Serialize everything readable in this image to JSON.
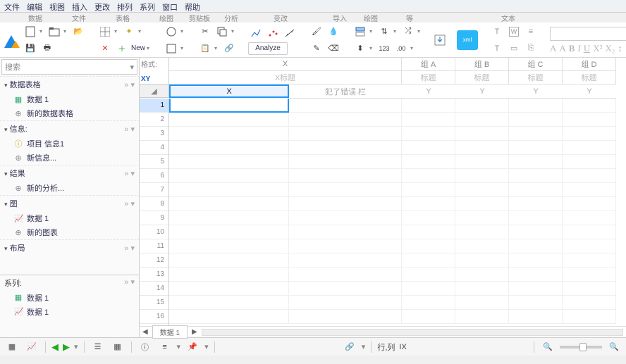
{
  "menu": [
    "文件",
    "编辑",
    "视图",
    "插入",
    "更改",
    "排列",
    "系列",
    "窗口",
    "帮助"
  ],
  "groups": [
    "数据",
    "文件",
    "表格",
    "绘图",
    "剪贴板",
    "分析",
    "变改",
    "导入",
    "绘图",
    "等",
    "文本"
  ],
  "toolbar": {
    "new_label": "New",
    "analyze_label": "Analyze"
  },
  "search": {
    "placeholder": "搜索"
  },
  "sidebar": {
    "sections": [
      {
        "title": "数据表格",
        "items": [
          {
            "icon": "grid",
            "label": "数据 1"
          },
          {
            "icon": "plus",
            "label": "新的数据表格"
          }
        ]
      },
      {
        "title": "信息:",
        "items": [
          {
            "icon": "info",
            "label": "项目 信息1"
          },
          {
            "icon": "plus",
            "label": "新信息..."
          }
        ]
      },
      {
        "title": "结果",
        "items": [
          {
            "icon": "plus",
            "label": "新的分析..."
          }
        ]
      },
      {
        "title": "图",
        "items": [
          {
            "icon": "chart",
            "label": "数据 1"
          },
          {
            "icon": "plus",
            "label": "新的图表"
          }
        ]
      },
      {
        "title": "布局",
        "items": []
      }
    ],
    "series_title": "系列:",
    "series_items": [
      {
        "label": "数据 1"
      },
      {
        "label": "数据 1"
      }
    ]
  },
  "sheet": {
    "format_label": "格式:",
    "format_type": "XY",
    "col_header_main": "X",
    "col_header_sub": "X标题",
    "groups": [
      "组 A",
      "组 B",
      "组 C",
      "组 D"
    ],
    "group_sub": [
      "标题",
      "标题",
      "标题",
      "标题"
    ],
    "x_label": "X",
    "error_label": "犯了错误.栏",
    "y_labels": [
      "Y",
      "Y",
      "Y",
      "Y"
    ],
    "rows": [
      1,
      2,
      3,
      4,
      5,
      6,
      7,
      8,
      9,
      10,
      11,
      12,
      13,
      14,
      15,
      16
    ],
    "active_row": 1,
    "bottom_sheet_label": "数据 1"
  },
  "status": {
    "row_col": "行,列",
    "rc_value": "IX"
  }
}
